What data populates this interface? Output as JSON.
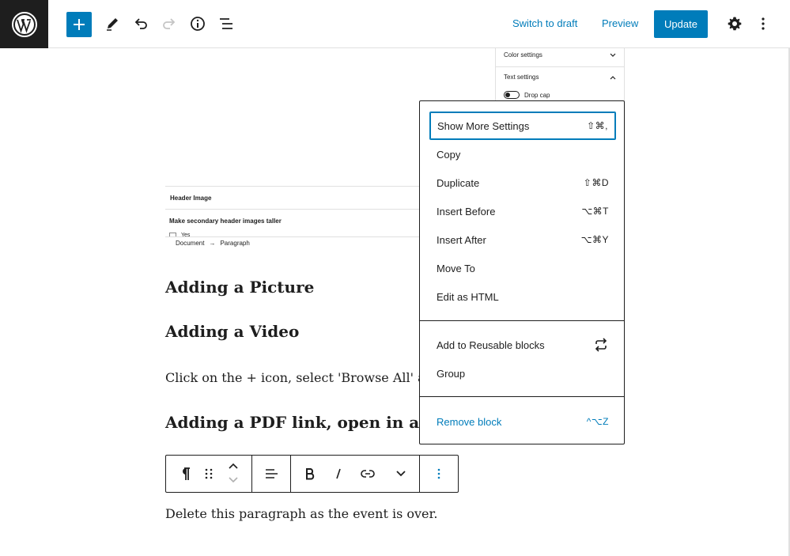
{
  "toolbar": {
    "wp_logo": "wordpress-logo",
    "switch_to_draft": "Switch to draft",
    "preview": "Preview",
    "update": "Update"
  },
  "sidebar_thumb": {
    "color_settings": "Color settings",
    "text_settings": "Text settings",
    "drop_cap": "Drop cap"
  },
  "thumb_block": {
    "header_image": "Header Image",
    "make_taller": "Make secondary header images taller",
    "yes": "Yes",
    "breadcrumb_document": "Document",
    "breadcrumb_arrow": "→",
    "breadcrumb_paragraph": "Paragraph"
  },
  "content": {
    "heading_picture": "Adding a Picture",
    "heading_video": "Adding a Video",
    "para_click": "Click on the + icon, select 'Browse All' at th",
    "heading_pdf": "Adding a PDF link, open in a nev",
    "para_delete": "Delete this paragraph as the event is over."
  },
  "menu": {
    "group1": [
      {
        "label": "Show More Settings",
        "shortcut": "⇧⌘,"
      },
      {
        "label": "Copy",
        "shortcut": ""
      },
      {
        "label": "Duplicate",
        "shortcut": "⇧⌘D"
      },
      {
        "label": "Insert Before",
        "shortcut": "⌥⌘T"
      },
      {
        "label": "Insert After",
        "shortcut": "⌥⌘Y"
      },
      {
        "label": "Move To",
        "shortcut": ""
      },
      {
        "label": "Edit as HTML",
        "shortcut": ""
      }
    ],
    "group2": [
      {
        "label": "Add to Reusable blocks",
        "shortcut": ""
      },
      {
        "label": "Group",
        "shortcut": ""
      }
    ],
    "remove": {
      "label": "Remove block",
      "shortcut": "^⌥Z"
    }
  },
  "colors": {
    "accent": "#007cba",
    "dark": "#1e1e1e",
    "border": "#e0e0e0"
  }
}
